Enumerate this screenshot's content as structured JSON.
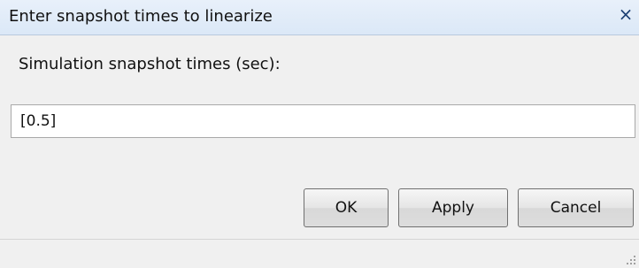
{
  "dialog": {
    "title": "Enter snapshot times to linearize",
    "close_icon": "close-icon",
    "close_glyph": "×"
  },
  "form": {
    "label": "Simulation snapshot times (sec):",
    "input_value": "[0.5]"
  },
  "buttons": {
    "ok_label": "OK",
    "apply_label": "Apply",
    "cancel_label": "Cancel"
  },
  "status_bar": {
    "resize_grip_icon": "resize-grip-icon"
  }
}
